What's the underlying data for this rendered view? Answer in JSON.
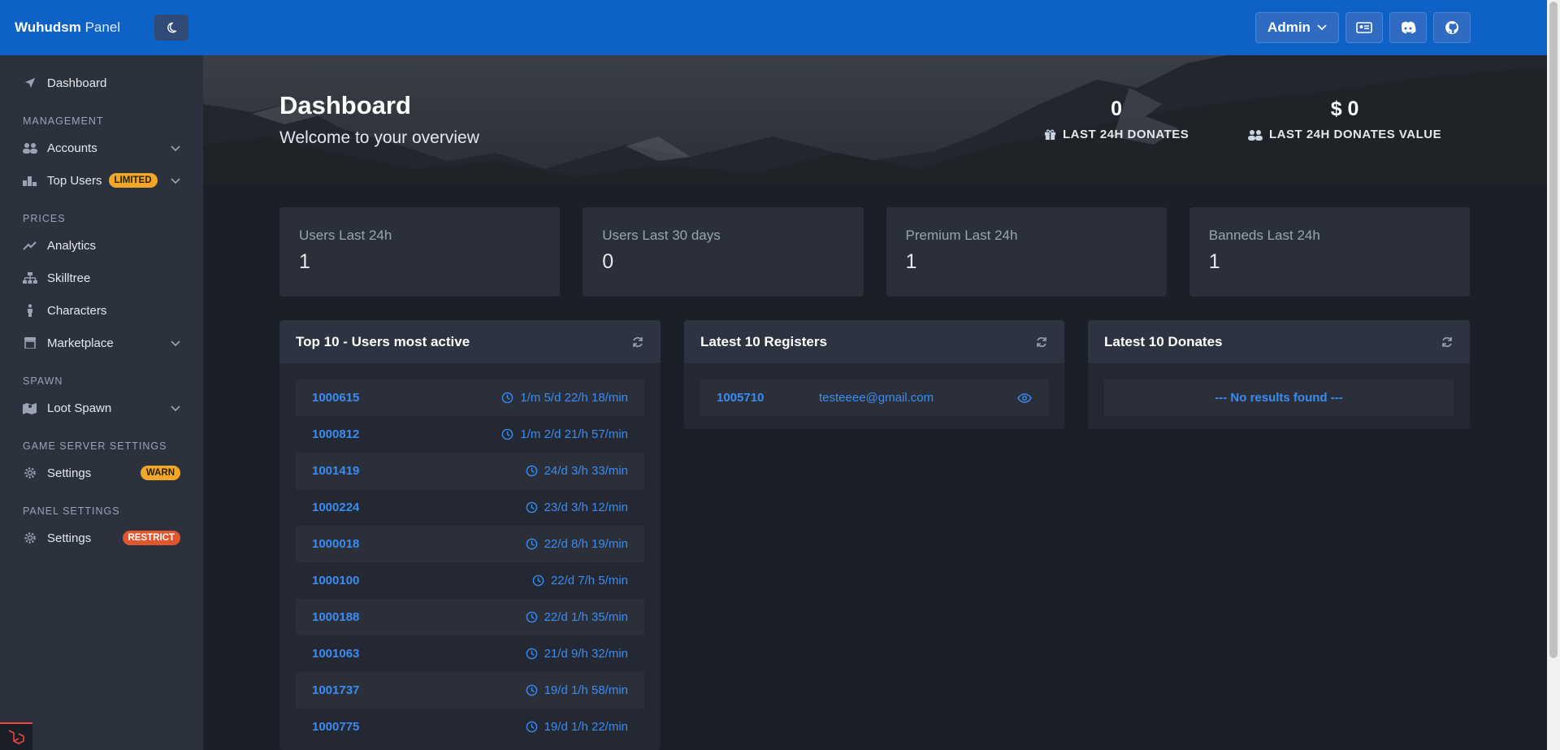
{
  "brand": {
    "name": "Wuhudsm",
    "suffix": "Panel"
  },
  "sidebar": {
    "dashboard": "Dashboard",
    "sections": {
      "management": "MANAGEMENT",
      "prices": "PRICES",
      "spawn": "SPAWN",
      "game_server": "GAME SERVER SETTINGS",
      "panel": "PANEL SETTINGS"
    },
    "items": {
      "accounts": "Accounts",
      "top_users": "Top Users",
      "top_users_badge": "LIMITED",
      "analytics": "Analytics",
      "skilltree": "Skilltree",
      "characters": "Characters",
      "marketplace": "Marketplace",
      "loot_spawn": "Loot Spawn",
      "game_settings": "Settings",
      "game_settings_badge": "WARN",
      "panel_settings": "Settings",
      "panel_settings_badge": "RESTRICT"
    }
  },
  "topbar": {
    "admin": "Admin"
  },
  "hero": {
    "title": "Dashboard",
    "subtitle": "Welcome to your overview",
    "stat1_value": "0",
    "stat1_label": "LAST 24H DONATES",
    "stat2_value": "$ 0",
    "stat2_label": "LAST 24H DONATES VALUE"
  },
  "cards": [
    {
      "title": "Users Last 24h",
      "value": "1"
    },
    {
      "title": "Users Last 30 days",
      "value": "0"
    },
    {
      "title": "Premium Last 24h",
      "value": "1"
    },
    {
      "title": "Banneds Last 24h",
      "value": "1"
    }
  ],
  "panels": {
    "active": {
      "title": "Top 10 - Users most active",
      "rows": [
        {
          "id": "1000615",
          "time": "1/m 5/d 22/h 18/min"
        },
        {
          "id": "1000812",
          "time": "1/m 2/d 21/h 57/min"
        },
        {
          "id": "1001419",
          "time": "24/d 3/h 33/min"
        },
        {
          "id": "1000224",
          "time": "23/d 3/h 12/min"
        },
        {
          "id": "1000018",
          "time": "22/d 8/h 19/min"
        },
        {
          "id": "1000100",
          "time": "22/d 7/h 5/min"
        },
        {
          "id": "1000188",
          "time": "22/d 1/h 35/min"
        },
        {
          "id": "1001063",
          "time": "21/d 9/h 32/min"
        },
        {
          "id": "1001737",
          "time": "19/d 1/h 58/min"
        },
        {
          "id": "1000775",
          "time": "19/d 1/h 22/min"
        }
      ]
    },
    "registers": {
      "title": "Latest 10 Registers",
      "rows": [
        {
          "id": "1005710",
          "email": "testeeee@gmail.com"
        }
      ]
    },
    "donates": {
      "title": "Latest 10 Donates",
      "empty": "--- No results found ---"
    }
  }
}
